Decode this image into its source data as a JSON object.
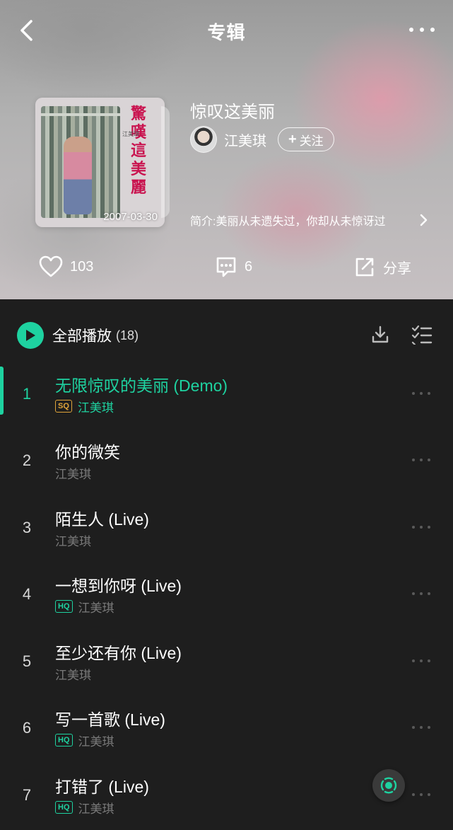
{
  "nav": {
    "title": "专辑"
  },
  "album": {
    "title": "惊叹这美丽",
    "cover_title": "驚嘆這美麗",
    "cover_artist": "江美琪",
    "cover_date": "2007-03-30",
    "artist": "江美琪",
    "follow_label": "关注",
    "intro": "简介:美丽从未遗失过，你却从未惊讶过"
  },
  "actions": {
    "like_count": "103",
    "comment_count": "6",
    "share_label": "分享"
  },
  "list": {
    "play_all_label": "全部播放",
    "count": "(18)",
    "tracks": [
      {
        "num": "1",
        "title": "无限惊叹的美丽 (Demo)",
        "artist": "江美琪",
        "badge": "SQ"
      },
      {
        "num": "2",
        "title": "你的微笑",
        "artist": "江美琪",
        "badge": ""
      },
      {
        "num": "3",
        "title": "陌生人 (Live)",
        "artist": "江美琪",
        "badge": ""
      },
      {
        "num": "4",
        "title": "一想到你呀 (Live)",
        "artist": "江美琪",
        "badge": "HQ"
      },
      {
        "num": "5",
        "title": "至少还有你 (Live)",
        "artist": "江美琪",
        "badge": ""
      },
      {
        "num": "6",
        "title": "写一首歌 (Live)",
        "artist": "江美琪",
        "badge": "HQ"
      },
      {
        "num": "7",
        "title": "打错了 (Live)",
        "artist": "江美琪",
        "badge": "HQ"
      }
    ]
  },
  "colors": {
    "accent": "#1ed2a0",
    "sq": "#e0a43a",
    "list_bg": "#1e1e1e"
  },
  "icons": [
    "back-icon",
    "more-icon",
    "heart-icon",
    "comment-icon",
    "share-icon",
    "play-icon",
    "download-icon",
    "multi-select-icon",
    "player-icon"
  ]
}
